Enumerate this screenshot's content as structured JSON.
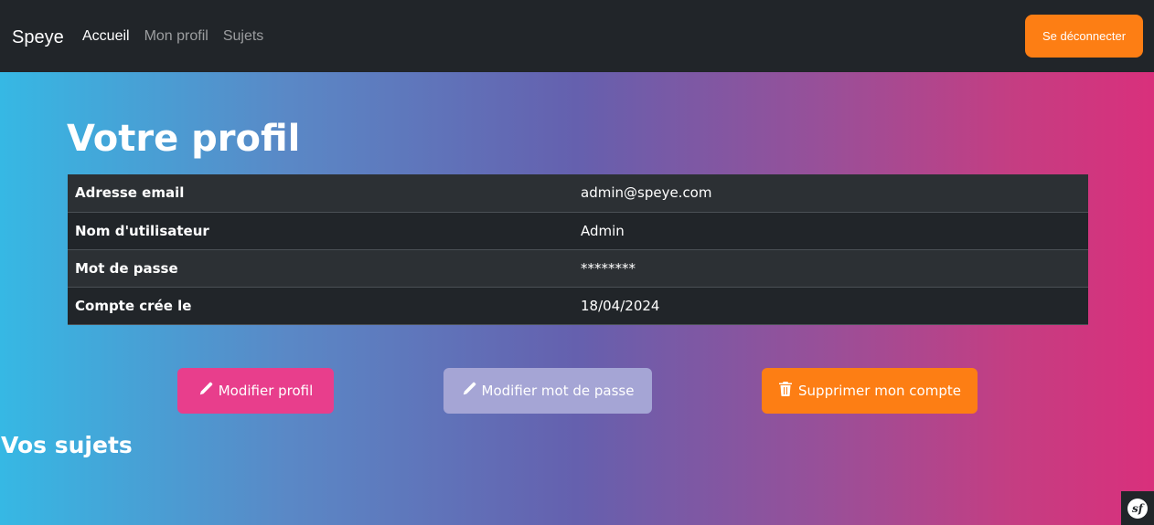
{
  "navbar": {
    "brand": "Speye",
    "links": [
      {
        "label": "Accueil",
        "active": true
      },
      {
        "label": "Mon profil",
        "active": false
      },
      {
        "label": "Sujets",
        "active": false
      }
    ],
    "logout_label": "Se déconnecter"
  },
  "page": {
    "title": "Votre profil",
    "profile_rows": [
      {
        "label": "Adresse email",
        "value": "admin@speye.com"
      },
      {
        "label": "Nom d'utilisateur",
        "value": "Admin"
      },
      {
        "label": "Mot de passe",
        "value": "********"
      },
      {
        "label": "Compte crée le",
        "value": "18/04/2024"
      }
    ],
    "actions": {
      "edit_profile": "Modifier profil",
      "edit_password": "Modifier mot de passe",
      "delete_account": "Supprimer mon compte"
    },
    "subjects_title": "Vos sujets"
  },
  "icons": {
    "edit": "pencil-icon",
    "delete": "trash-icon",
    "debug": "symfony-logo-icon"
  },
  "colors": {
    "navbar_bg": "#212529",
    "orange": "#fd7e14",
    "pink": "#e83e8c",
    "lavender": "#a5a5d5"
  },
  "debug_badge": "sf"
}
